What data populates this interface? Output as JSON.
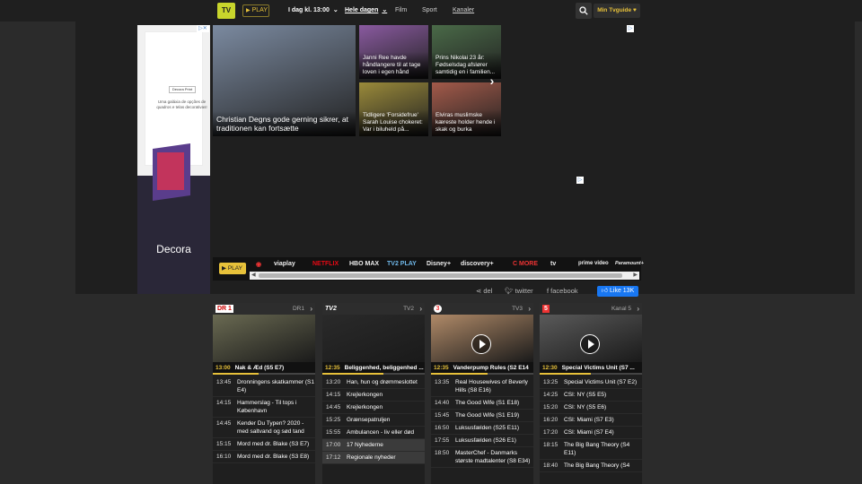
{
  "header": {
    "logo_text": "TV",
    "play_label": "PLAY",
    "time_label": "I dag kl. 13:00",
    "day_label": "Hele dagen",
    "film": "Film",
    "sport": "Sport",
    "kanaler": "Kanaler",
    "min_tvguide": "Min Tvguide"
  },
  "left_ad": {
    "brand_box": "Decora Print",
    "text": "Uma galáxia de opções de quadros e telas decorativas!",
    "brand": "Decora",
    "info_icon": "ad-info-icon"
  },
  "news": [
    {
      "caption": "Christian Degns gode gerning sikrer, at traditionen kan fortsætte",
      "color": "#7b8aa0"
    },
    {
      "caption": "Janni Ree havde håndlangere til at tage loven i egen hånd",
      "color": "#8a5aa0"
    },
    {
      "caption": "Prins Nikolai 23 år: Fødselsdag afslører samtidig en i familien...",
      "color": "#4a6a48"
    },
    {
      "caption": "Tidligere 'Forsidefrue' Sarah Louise chokeret: Var i biluheld på...",
      "color": "#9a8a3a"
    },
    {
      "caption": "Elviras muslimske kæreste holder hende i skak og burka",
      "color": "#a35a4a"
    }
  ],
  "stream_bar": {
    "play_label": "PLAY",
    "services": [
      "viaplay",
      "NETFLIX",
      "HBO MAX",
      "TV2 PLAY",
      "Disney+",
      "discovery+",
      "C MORE",
      "tv",
      "prime video",
      "Paramount+"
    ]
  },
  "share": {
    "del": "del",
    "twitter": "twitter",
    "facebook": "facebook",
    "like": "Like 13K"
  },
  "channels": [
    {
      "logo": "DR 1",
      "name": "DR1",
      "now_time": "13:00",
      "now_title": "Nak & Æd (S5 E7)",
      "progress": 0.45,
      "thumb_color": "#6a6a52",
      "play_icon": false,
      "rows": [
        {
          "time": "13:45",
          "title": "Dronningens skatkammer (S1 E4)"
        },
        {
          "time": "14:15",
          "title": "Hammerslag - Til tops i København"
        },
        {
          "time": "14:45",
          "title": "Kender Du Typen? 2020 - med saltvand og sød tand"
        },
        {
          "time": "15:15",
          "title": "Mord med dr. Blake (S3 E7)"
        },
        {
          "time": "16:10",
          "title": "Mord med dr. Blake (S3 E8)"
        }
      ]
    },
    {
      "logo": "TV2",
      "name": "TV2",
      "now_time": "12:35",
      "now_title": "Beliggenhed, beliggenhed ...",
      "progress": 0.6,
      "thumb_color": "#2a2a2a",
      "play_icon": false,
      "rows": [
        {
          "time": "13:20",
          "title": "Han, hun og drømmeslottet"
        },
        {
          "time": "14:15",
          "title": "Krejlerkongen"
        },
        {
          "time": "14:45",
          "title": "Krejlerkongen"
        },
        {
          "time": "15:25",
          "title": "Grænsepatruljen"
        },
        {
          "time": "15:55",
          "title": "Ambulancen - liv eller død"
        },
        {
          "time": "17:00",
          "title": "17 Nyhederne",
          "hi": true
        },
        {
          "time": "17:12",
          "title": "Regionale nyheder",
          "hi": true
        }
      ]
    },
    {
      "logo": "3",
      "name": "TV3",
      "now_time": "12:35",
      "now_title": "Vanderpump Rules (S2 E14",
      "progress": 0.55,
      "thumb_color": "#b08a68",
      "play_icon": true,
      "rows": [
        {
          "time": "13:35",
          "title": "Real Housewives of Beverly Hills (S8 E16)"
        },
        {
          "time": "14:40",
          "title": "The Good Wife (S1 E18)"
        },
        {
          "time": "15:45",
          "title": "The Good Wife (S1 E19)"
        },
        {
          "time": "16:50",
          "title": "Luksusfælden (S25 E11)"
        },
        {
          "time": "17:55",
          "title": "Luksusfælden (S26 E1)"
        },
        {
          "time": "18:50",
          "title": "MasterChef - Danmarks største madtalenter (S8 E34)"
        }
      ]
    },
    {
      "logo": "5",
      "name": "Kanal 5",
      "now_time": "12:30",
      "now_title": "Special Victims Unit (S7 ...",
      "progress": 0.5,
      "thumb_color": "#5a5a5a",
      "play_icon": true,
      "rows": [
        {
          "time": "13:25",
          "title": "Special Victims Unit (S7 E2)"
        },
        {
          "time": "14:25",
          "title": "CSI: NY (S5 E5)"
        },
        {
          "time": "15:20",
          "title": "CSI: NY (S5 E6)"
        },
        {
          "time": "16:20",
          "title": "CSI: Miami (S7 E3)"
        },
        {
          "time": "17:20",
          "title": "CSI: Miami (S7 E4)"
        },
        {
          "time": "18:15",
          "title": "The Big Bang Theory (S4 E11)"
        },
        {
          "time": "18:40",
          "title": "The Big Bang Theory (S4"
        }
      ]
    }
  ]
}
